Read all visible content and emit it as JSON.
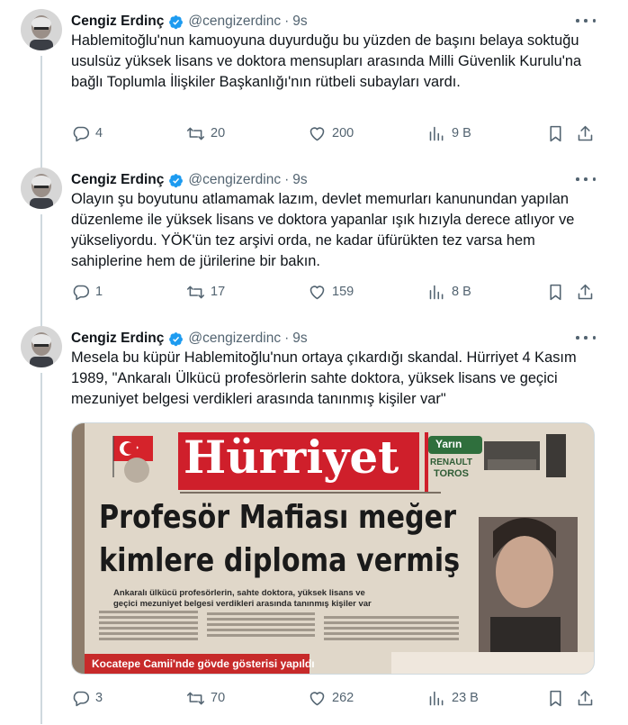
{
  "tweets": [
    {
      "author": {
        "name": "Cengiz Erdinç",
        "handle": "@cengizerdinc",
        "time": "9s"
      },
      "text": "Hablemitoğlu'nun kamuoyuna duyurduğu bu yüzden de başını belaya soktuğu usulsüz yüksek lisans ve doktora mensupları arasında Milli Güvenlik Kurulu'na bağlı Toplumla İlişkiler Başkanlığı'nın rütbeli subayları vardı.",
      "stats": {
        "replies": "4",
        "retweets": "20",
        "likes": "200",
        "views": "9 B"
      }
    },
    {
      "author": {
        "name": "Cengiz Erdinç",
        "handle": "@cengizerdinc",
        "time": "9s"
      },
      "text": "Olayın şu boyutunu atlamamak lazım, devlet memurları kanunundan yapılan düzenleme ile yüksek lisans ve doktora yapanlar ışık hızıyla derece atlıyor ve yükseliyordu. YÖK'ün tez arşivi orda, ne kadar üfürükten tez varsa hem sahiplerine hem de jürilerine bir bakın.",
      "stats": {
        "replies": "1",
        "retweets": "17",
        "likes": "159",
        "views": "8 B"
      }
    },
    {
      "author": {
        "name": "Cengiz Erdinç",
        "handle": "@cengizerdinc",
        "time": "9s"
      },
      "text": "Mesela bu küpür Hablemitoğlu'nun ortaya çıkardığı skandal. Hürriyet 4 Kasım 1989, \"Ankaralı Ülkücü profesörlerin sahte doktora, yüksek lisans ve geçici mezuniyet belgesi verdikleri arasında tanınmış kişiler var\"",
      "stats": {
        "replies": "3",
        "retweets": "70",
        "likes": "262",
        "views": "23 B"
      },
      "media": {
        "masthead": "Hürriyet",
        "headline_line1": "Profesör Mafiası meğer",
        "headline_line2": "kimlere diploma vermiş",
        "subhead_line1": "Ankaralı ülkücü profesörlerin, sahte doktora, yüksek lisans ve",
        "subhead_line2": "geçici mezuniyet belgesi verdikleri arasında tanınmış kişiler var",
        "bottom_strip": "Kocatepe Camii'nde gövde gösterisi yapıldı",
        "ad_label": "Yarın",
        "ad_brand": "RENAULT",
        "ad_model": "TOROS"
      }
    }
  ],
  "colors": {
    "verified": "#1d9bf0",
    "muted": "#536471",
    "text": "#0f1419",
    "line": "#cfd9de"
  }
}
